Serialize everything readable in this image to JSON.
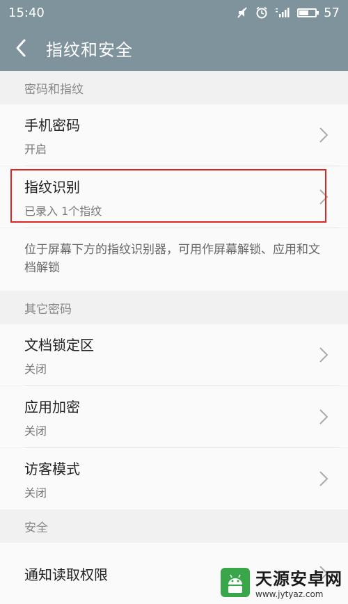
{
  "status_bar": {
    "time": "15:40",
    "battery": "57",
    "battery_level_percent": 57,
    "icons": [
      "mute-icon",
      "alarm-icon",
      "signal-icon",
      "battery-icon"
    ]
  },
  "title_bar": {
    "title": "指纹和安全",
    "back_icon": "back-arrow-icon"
  },
  "sections": {
    "fingerprint_header": "密码和指纹",
    "phone_password": {
      "label": "手机密码",
      "status": "开启"
    },
    "fingerprint_recognition": {
      "label": "指纹识别",
      "status": "已录入 1个指纹"
    },
    "fingerprint_description": "位于屏幕下方的指纹识别器，可用作屏幕解锁、应用和文档解锁",
    "other_header": "其它密码",
    "doc_lock": {
      "label": "文档锁定区",
      "status": "关闭"
    },
    "app_encrypt": {
      "label": "应用加密",
      "status": "关闭"
    },
    "guest_mode": {
      "label": "访客模式",
      "status": "关闭"
    },
    "security_header": "安全",
    "notification_access": {
      "label": "通知读取权限"
    }
  },
  "watermark": {
    "name": "天源安卓网",
    "url": "www.jytyaz.com"
  },
  "colors": {
    "toolbar": "#7f939c",
    "highlight": "#e02424",
    "background": "#f1f1f1",
    "row_background": "#fafafa"
  }
}
